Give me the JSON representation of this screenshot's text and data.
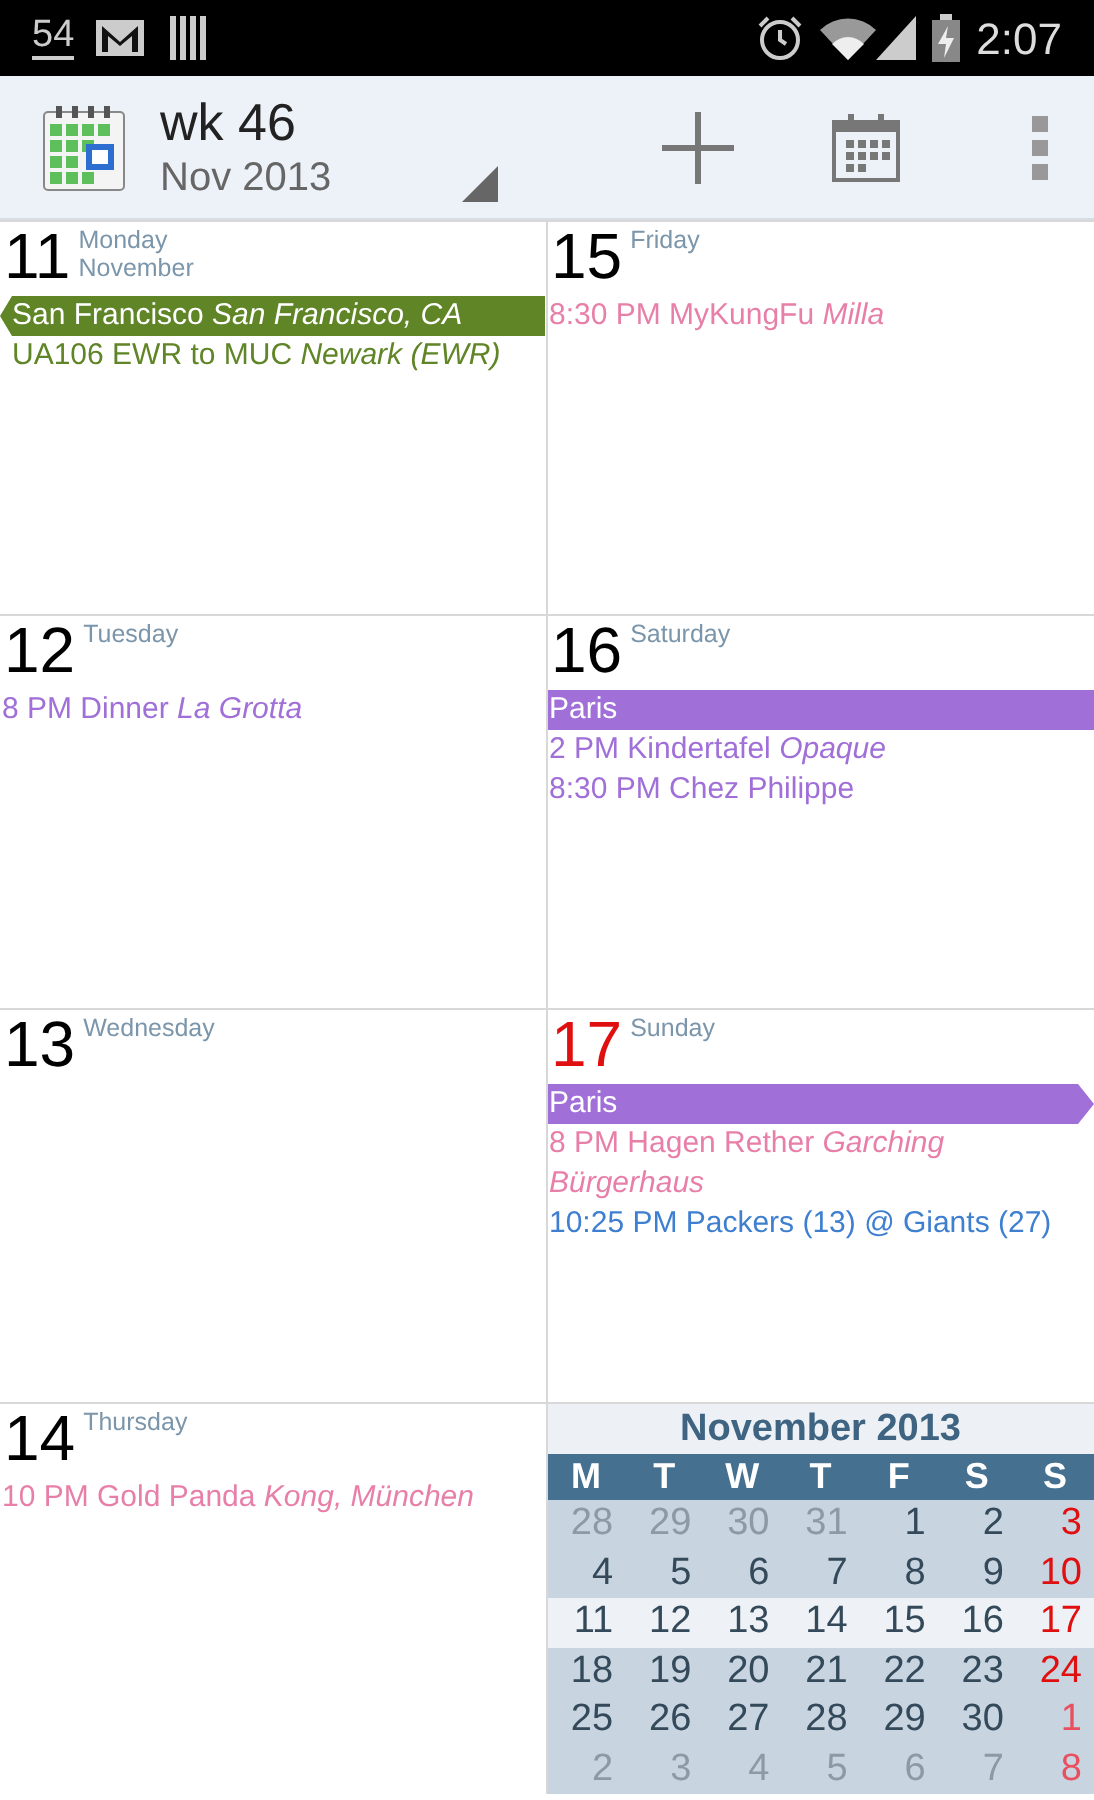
{
  "status_bar": {
    "notification_count": "54",
    "time": "2:07"
  },
  "toolbar": {
    "title": "wk 46",
    "subtitle": "Nov 2013"
  },
  "days": [
    {
      "date": "11",
      "weekday": "Monday",
      "month": "November",
      "kind": "weekday",
      "events": [
        {
          "kind": "banner",
          "text": "San Francisco *San Francisco, CA*",
          "color": "#5f8526",
          "continues_before": true
        },
        {
          "kind": "line",
          "text": "UA106 EWR to MUC *Newark (EWR)*",
          "color": "#5f8526"
        }
      ]
    },
    {
      "date": "12",
      "weekday": "Tuesday",
      "kind": "weekday",
      "events": [
        {
          "kind": "line",
          "text": "8 PM Dinner *La Grotta*",
          "color": "#a070d8"
        }
      ]
    },
    {
      "date": "13",
      "weekday": "Wednesday",
      "kind": "weekday"
    },
    {
      "date": "14",
      "weekday": "Thursday",
      "kind": "weekday",
      "events": [
        {
          "kind": "line",
          "text": "10 PM Gold Panda *Kong, München*",
          "color": "#e87fa8"
        }
      ]
    },
    {
      "date": "15",
      "weekday": "Friday",
      "kind": "weekday",
      "events": [
        {
          "kind": "line",
          "text": "8:30 PM MyKungFu *Milla*",
          "color": "#e87fa8"
        }
      ]
    },
    {
      "date": "16",
      "weekday": "Saturday",
      "kind": "weekday",
      "events": [
        {
          "kind": "banner",
          "text": "Paris",
          "color": "#a070d8"
        },
        {
          "kind": "line",
          "text": "2 PM Kindertafel *Opaque*",
          "color": "#a070d8"
        },
        {
          "kind": "line",
          "text": "8:30 PM Chez Philippe",
          "color": "#a070d8"
        }
      ]
    },
    {
      "date": "17",
      "weekday": "Sunday",
      "kind": "sunday",
      "events": [
        {
          "kind": "banner",
          "text": "Paris",
          "color": "#a070d8",
          "continues_after": true
        },
        {
          "kind": "line",
          "text": "8 PM Hagen Rether *Garching Bürgerhaus*",
          "color": "#e87fa8"
        },
        {
          "kind": "line",
          "text": "10:25 PM Packers (13) @ Giants (27)",
          "color": "#3f7fd0"
        }
      ]
    }
  ],
  "mini_month": {
    "title": "November 2013",
    "weekdays": [
      "M",
      "T",
      "W",
      "T",
      "F",
      "S",
      "S"
    ],
    "weeks": [
      {
        "selected": false,
        "days": [
          {
            "text": "28",
            "outside": true
          },
          {
            "text": "29",
            "outside": true
          },
          {
            "text": "30",
            "outside": true
          },
          {
            "text": "31",
            "outside": true
          },
          {
            "text": "1",
            "outside": false
          },
          {
            "text": "2",
            "outside": false
          },
          {
            "text": "3",
            "outside": false
          }
        ]
      },
      {
        "selected": false,
        "days": [
          {
            "text": "4",
            "outside": false
          },
          {
            "text": "5",
            "outside": false
          },
          {
            "text": "6",
            "outside": false
          },
          {
            "text": "7",
            "outside": false
          },
          {
            "text": "8",
            "outside": false
          },
          {
            "text": "9",
            "outside": false
          },
          {
            "text": "10",
            "outside": false
          }
        ]
      },
      {
        "selected": true,
        "days": [
          {
            "text": "11",
            "outside": false
          },
          {
            "text": "12",
            "outside": false
          },
          {
            "text": "13",
            "outside": false
          },
          {
            "text": "14",
            "outside": false
          },
          {
            "text": "15",
            "outside": false
          },
          {
            "text": "16",
            "outside": false
          },
          {
            "text": "17",
            "outside": false
          }
        ]
      },
      {
        "selected": false,
        "days": [
          {
            "text": "18",
            "outside": false
          },
          {
            "text": "19",
            "outside": false
          },
          {
            "text": "20",
            "outside": false
          },
          {
            "text": "21",
            "outside": false
          },
          {
            "text": "22",
            "outside": false
          },
          {
            "text": "23",
            "outside": false
          },
          {
            "text": "24",
            "outside": false
          }
        ]
      },
      {
        "selected": false,
        "days": [
          {
            "text": "25",
            "outside": false
          },
          {
            "text": "26",
            "outside": false
          },
          {
            "text": "27",
            "outside": false
          },
          {
            "text": "28",
            "outside": false
          },
          {
            "text": "29",
            "outside": false
          },
          {
            "text": "30",
            "outside": false
          },
          {
            "text": "1",
            "outside": true
          }
        ]
      },
      {
        "selected": false,
        "days": [
          {
            "text": "2",
            "outside": true
          },
          {
            "text": "3",
            "outside": true
          },
          {
            "text": "4",
            "outside": true
          },
          {
            "text": "5",
            "outside": true
          },
          {
            "text": "6",
            "outside": true
          },
          {
            "text": "7",
            "outside": true
          },
          {
            "text": "8",
            "outside": true
          }
        ]
      }
    ]
  }
}
